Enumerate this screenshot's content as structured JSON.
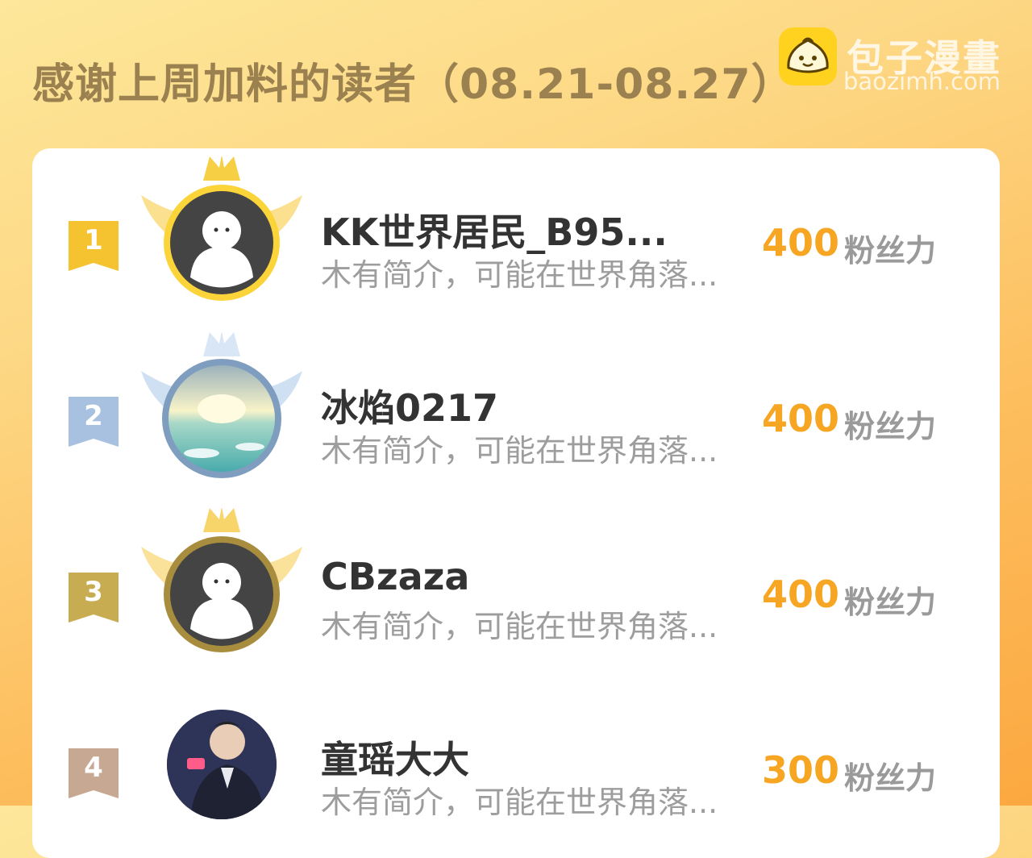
{
  "header": {
    "title": "感谢上周加料的读者（08.21-08.27）"
  },
  "logo": {
    "name": "包子漫畫",
    "domain": "baozimh.com",
    "icon": "bun-logo-icon"
  },
  "readers": [
    {
      "rank": "1",
      "name": "KK世界居民_B95...",
      "bio": "木有简介，可能在世界角落...",
      "score": "400",
      "unit": "粉丝力",
      "avatar": "default-avatar"
    },
    {
      "rank": "2",
      "name": "冰焰0217",
      "bio": "木有简介，可能在世界角落...",
      "score": "400",
      "unit": "粉丝力",
      "avatar": "sunset-sea-photo"
    },
    {
      "rank": "3",
      "name": "CBzaza",
      "bio": "木有简介，可能在世界角落...",
      "score": "400",
      "unit": "粉丝力",
      "avatar": "default-avatar"
    },
    {
      "rank": "4",
      "name": "童瑶大大",
      "bio": "木有简介，可能在世界角落...",
      "score": "300",
      "unit": "粉丝力",
      "avatar": "person-photo"
    }
  ],
  "colors": {
    "gold": "#f5c330",
    "silver": "#a8c1e0",
    "bronze": "#c7ac52",
    "fourth": "#c7a893",
    "score": "#f6a623",
    "title": "#9b8150"
  }
}
